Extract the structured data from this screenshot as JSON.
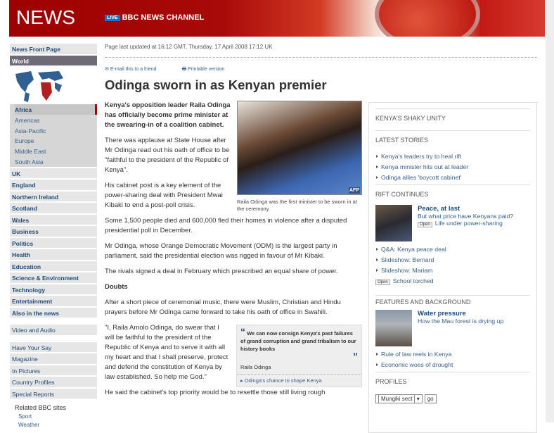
{
  "header": {
    "logo": "NEWS",
    "live_badge": "LIVE",
    "channel": "BBC NEWS CHANNEL"
  },
  "sidebar": {
    "front": "News Front Page",
    "world": "World",
    "regions": [
      "Africa",
      "Americas",
      "Asia-Pacific",
      "Europe",
      "Middle East",
      "South Asia"
    ],
    "sections": [
      "UK",
      "England",
      "Northern Ireland",
      "Scotland",
      "Wales",
      "Business",
      "Politics",
      "Health",
      "Education",
      "Science & Environment",
      "Technology",
      "Entertainment",
      "Also in the news"
    ],
    "video": "Video and Audio",
    "extras": [
      "Have Your Say",
      "Magazine",
      "In Pictures",
      "Country Profiles",
      "Special Reports"
    ],
    "related_title": "Related BBC sites",
    "related": [
      "Sport",
      "Weather"
    ]
  },
  "article": {
    "updated": "Page last updated at 16:12 GMT, Thursday, 17 April 2008 17:12 UK",
    "email": "E-mail this to a friend",
    "print": "Printable version",
    "title": "Odinga sworn in as Kenyan premier",
    "lead": "Kenya's opposition leader Raila Odinga has officially become prime minister at the swearing-in of a coalition cabinet.",
    "photo_caption": "Raila Odinga was the first minister to be sworn in at the ceremony",
    "photo_credit": "AFP",
    "p1": "There was applause at State House after Mr Odinga read out his oath of office to be \"faithful to the president of the Republic of Kenya\".",
    "p2": "His cabinet post is a key element of the power-sharing deal with President Mwai Kibaki to end a post-poll crisis.",
    "p3": "Some 1,500 people died and 600,000 fled their homes in violence after a disputed presidential poll in December.",
    "p4": "Mr Odinga, whose Orange Democratic Movement (ODM) is the largest party in parliament, said the presidential election was rigged in favour of Mr Kibaki.",
    "p5": "The rivals signed a deal in February which prescribed an equal share of power.",
    "subhead": "Doubts",
    "p6": "After a short piece of ceremonial music, there were Muslim, Christian and Hindu prayers before Mr Odinga came forward to take his oath of office in Swahili.",
    "p7": "\"I, Raila Amolo Odinga, do swear that I will be faithful to the president of the Republic of Kenya and to serve it with all my heart and that I shall preserve, protect and defend the constitution of Kenya by law established. So help me God.\"",
    "p8": "He said the cabinet's top priority would be to resettle those still living rough",
    "quote": {
      "text": "We can now consign Kenya's past failures of grand corruption and grand tribalism to our history books",
      "open_mark": "“",
      "close_mark": "”",
      "who": "Raila Odinga",
      "link": "Odinga's chance to shape Kenya"
    }
  },
  "right": {
    "title": "KENYA'S SHAKY UNITY",
    "latest_title": "LATEST STORIES",
    "latest": [
      "Kenya's leaders try to heal rift",
      "Kenya minister hits out at leader",
      "Odinga allies 'boycott cabinet'"
    ],
    "rift_title": "RIFT CONTINUES",
    "rift_feat": {
      "title": "Peace, at last",
      "sub": "But what price have Kenyans paid?",
      "open": "Open",
      "open_link": "Life under power-sharing"
    },
    "rift_links": [
      "Q&A: Kenya peace deal",
      "Slideshow: Bernard",
      "Slideshow: Mariam"
    ],
    "rift_open": "Open",
    "rift_open_link": "School torched",
    "features_title": "FEATURES AND BACKGROUND",
    "feat": {
      "title": "Water pressure",
      "sub": "How the Mau forest is drying up"
    },
    "features_links": [
      "Rule of law reels in Kenya",
      "Economic woes of drought"
    ],
    "profiles_title": "PROFILES",
    "profiles_select": "Mungiki sect",
    "go": "go"
  }
}
